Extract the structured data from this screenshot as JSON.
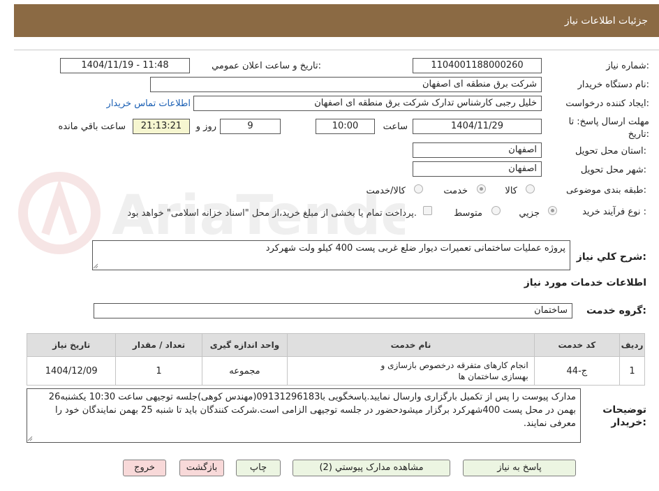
{
  "header": {
    "title": "جزئیات اطلاعات نیاز"
  },
  "watermark": {
    "text": "AriaTender.neT"
  },
  "fields": {
    "need_number_label": "شماره نیاز:",
    "need_number": "1104001188000260",
    "announce_label": "تاریخ و ساعت اعلان عمومي:",
    "announce_value": "1404/11/19 - 11:48",
    "buyer_label": "نام دستگاه خریدار:",
    "buyer": "شرکت برق منطقه ای اصفهان",
    "creator_label": "ایجاد کننده درخواست:",
    "creator": "خلیل رجبی کارشناس تدارک شرکت برق منطقه ای اصفهان",
    "contact_link": "اطلاعات تماس خریدار",
    "deadline_label": "مهلت ارسال پاسخ: تا تاریخ:",
    "deadline_date": "1404/11/29",
    "time_label": "ساعت",
    "deadline_time": "10:00",
    "days": "9",
    "days_label": "روز و",
    "remaining_time": "21:13:21",
    "remaining_label": "ساعت باقي مانده",
    "province_label": "استان محل تحویل:",
    "province": "اصفهان",
    "city_label": "شهر محل تحویل:",
    "city": "اصفهان",
    "category_label": "طبقه بندی موضوعی:",
    "category_options": [
      "کالا",
      "خدمت",
      "کالا/خدمت"
    ],
    "process_label": "نوع فرآیند خرید :",
    "process_options": [
      "جزيي",
      "متوسط"
    ],
    "payment_note": "پرداخت تمام یا بخشی از مبلغ خرید،از محل \"اسناد خزانه اسلامی\" خواهد بود."
  },
  "summary": {
    "label": "شرح کلي نیاز:",
    "value": "پروژه عملیات ساختمانی تعمیرات دیوار ضلع غربی پست 400 کیلو ولت شهرکرد"
  },
  "services": {
    "section_title": "اطلاعات خدمات مورد نیاز",
    "group_label": "گروه خدمت:",
    "group_value": "ساختمان",
    "columns": [
      "ردیف",
      "کد خدمت",
      "نام خدمت",
      "واحد اندازه گیری",
      "تعداد / مقدار",
      "تاریخ نیاز"
    ],
    "rows": [
      [
        "1",
        "ج-44",
        "انجام کارهای متفرقه درخصوص بازسازی و بهسازی ساختمان ها",
        "مجموعه",
        "1",
        "1404/12/09"
      ]
    ]
  },
  "buyer_notes": {
    "label": "توضیحات خریدار:",
    "value": "مدارک پیوست را پس از تکمیل بارگزاری وارسال نمایید.پاسخگویی با09131296183(مهندس کوهی)جلسه توجیهی ساعت 10:30 یکشنبه26 بهمن در محل پست 400شهرکرد برگزار میشودحضور در جلسه توجیهی الزامی است.شرکت کنندگان باید تا شنبه 25 بهمن نمایندگان خود را معرفی نمایند."
  },
  "buttons": {
    "reply": "پاسخ به نیاز",
    "attachments": "مشاهده مدارک پیوستي (2)",
    "print": "چاپ",
    "back": "بازگشت",
    "exit": "خروج"
  },
  "colors": {
    "header_bg": "#8b6a44",
    "link": "#1a5fb4",
    "btn_green": "#ecf5e2",
    "btn_red": "#f8d9d9"
  }
}
